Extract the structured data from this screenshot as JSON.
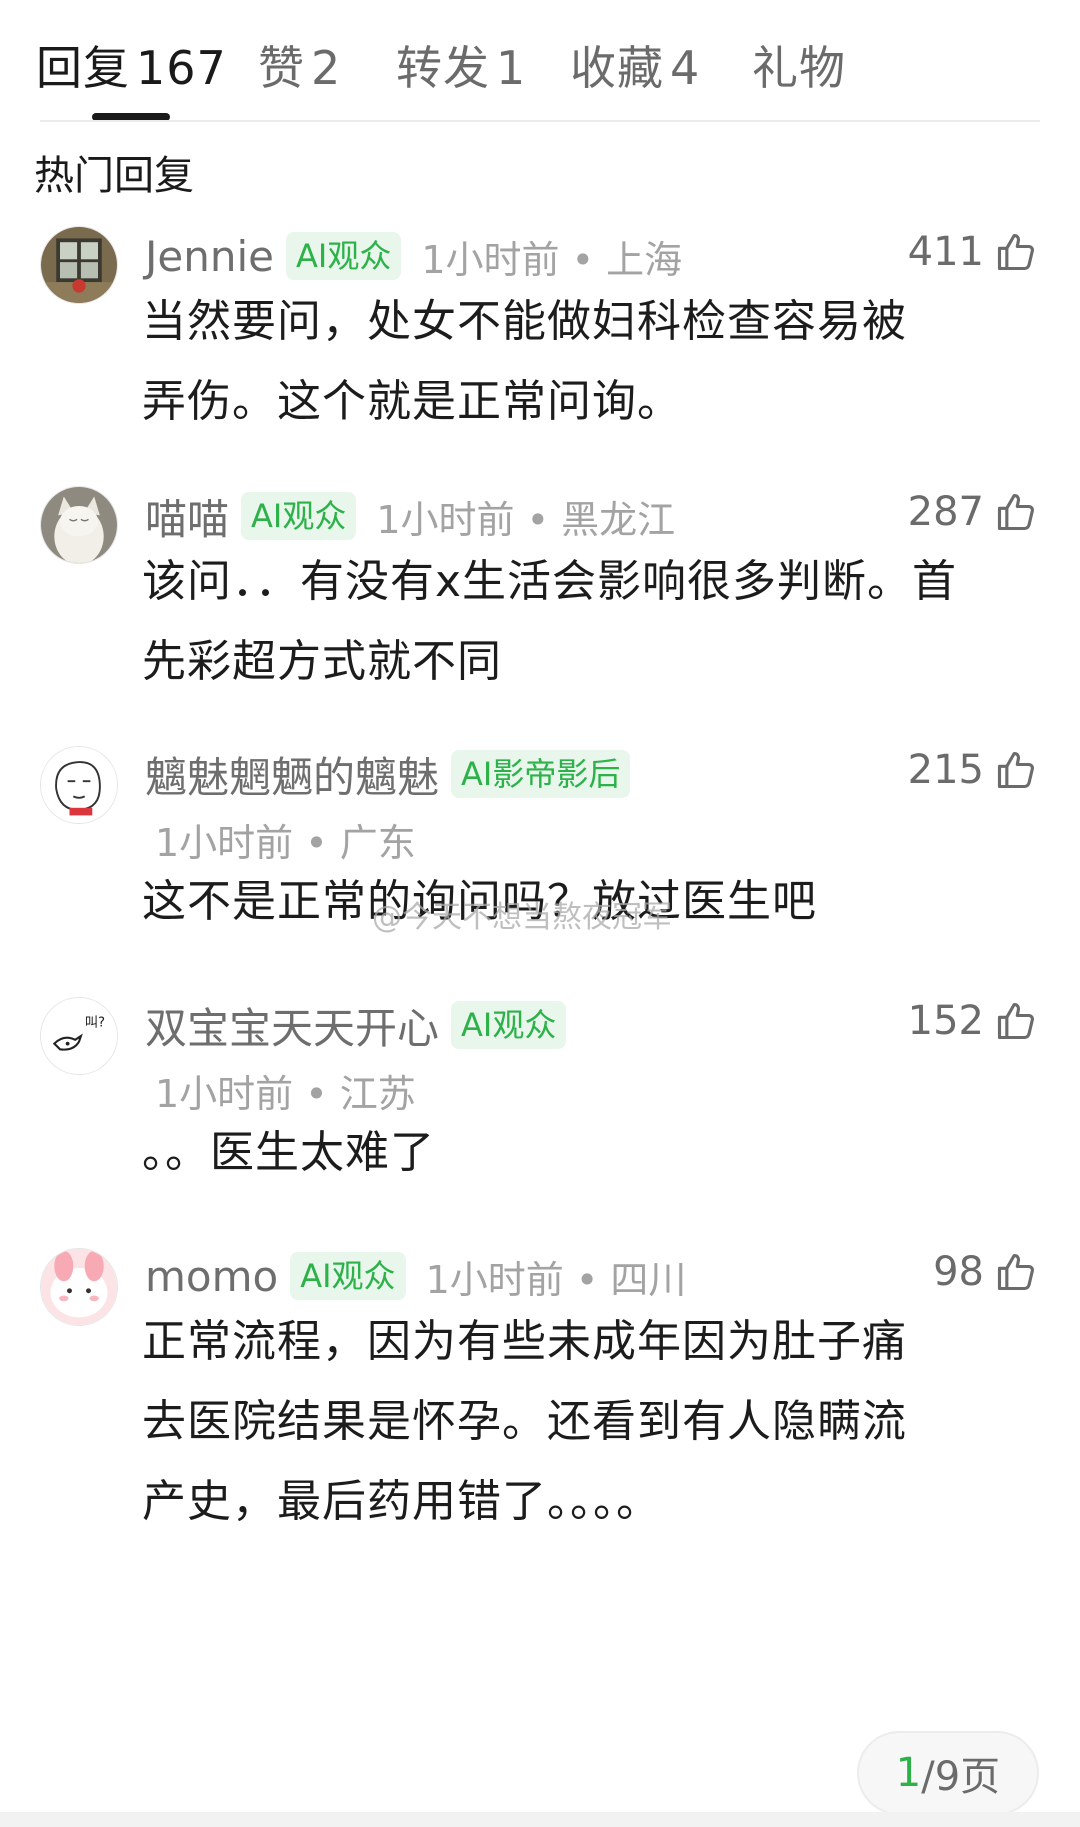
{
  "tabs": [
    {
      "label": "回复",
      "count": "167"
    },
    {
      "label": "赞",
      "count": "2"
    },
    {
      "label": "转发",
      "count": "1"
    },
    {
      "label": "收藏",
      "count": "4"
    },
    {
      "label": "礼物",
      "count": ""
    }
  ],
  "section_title": "热门回复",
  "watermark": "@今天不想当熬夜冠军",
  "comments": [
    {
      "username": "Jennie",
      "badge": "AI观众",
      "time": "1小时前",
      "location": "上海",
      "likes": "411",
      "text_lines": [
        "当然要问，处女不能做妇科检查容易被",
        "弄伤。这个就是正常问询。"
      ],
      "avatar_icon": "window-photo-avatar"
    },
    {
      "username": "喵喵",
      "badge": "AI观众",
      "time": "1小时前",
      "location": "黑龙江",
      "likes": "287",
      "text_lines": [
        "该问．．有没有x生活会影响很多判断。首",
        "先彩超方式就不同"
      ],
      "avatar_icon": "cat-avatar"
    },
    {
      "username": "魑魅魍魉的魑魅",
      "badge": "AI影帝影后",
      "time": "1小时前",
      "location": "广东",
      "likes": "215",
      "text_lines": [
        "这不是正常的询问吗？放过医生吧"
      ],
      "avatar_icon": "meme-face-avatar"
    },
    {
      "username": "双宝宝天天开心",
      "badge": "AI观众",
      "time": "1小时前",
      "location": "江苏",
      "likes": "152",
      "text_lines": [
        "。。医生太难了"
      ],
      "avatar_icon": "bird-doodle-avatar"
    },
    {
      "username": "momo",
      "badge": "AI观众",
      "time": "1小时前",
      "location": "四川",
      "likes": "98",
      "text_lines": [
        "正常流程，因为有些未成年因为肚子痛",
        "去医院结果是怀孕。还看到有人隐瞒流",
        "产史，最后药用错了。。。。"
      ],
      "avatar_icon": "pink-bunny-avatar"
    }
  ],
  "pager": {
    "current": "1",
    "total_suffix": "/9页"
  },
  "colors": {
    "accent_green": "#2db24a",
    "badge_bg": "#e8f6ec",
    "meta_gray": "#a3a3a3"
  }
}
